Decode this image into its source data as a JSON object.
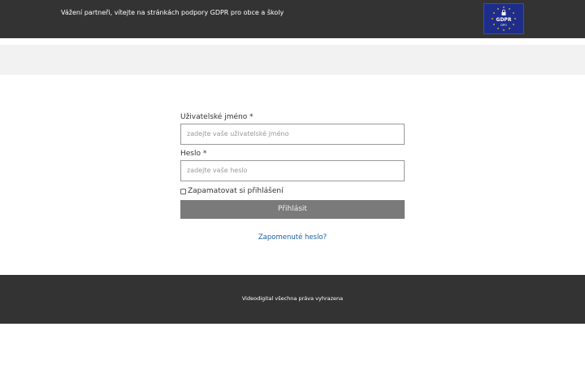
{
  "header": {
    "greeting": "Vážení partneři, vítejte na stránkách podpory GDPR pro obce a školy",
    "logo_text": "GDPR",
    "logo_subtext": "DPO",
    "logo_icon": "eu-stars-lock-icon"
  },
  "login": {
    "username_label": "Uživatelské jméno *",
    "username_placeholder": "zadejte vaše uživatelské jméno",
    "password_label": "Heslo *",
    "password_placeholder": "zadejte vaše heslo",
    "remember_label": "Zapamatovat si přihlášení",
    "remember_checked": false,
    "submit_label": "Přihlásit",
    "forgot_label": "Zapomenuté heslo?"
  },
  "footer": {
    "copyright": "Videodigital všechna práva vyhrazena"
  },
  "colors": {
    "header_bg": "#333333",
    "footer_bg": "#333333",
    "band_bg": "#f2f2f2",
    "button_bg": "#7a7a7a",
    "link": "#1a5fa8",
    "logo_bg": "#1f2d8a",
    "logo_stars": "#f5c518"
  }
}
